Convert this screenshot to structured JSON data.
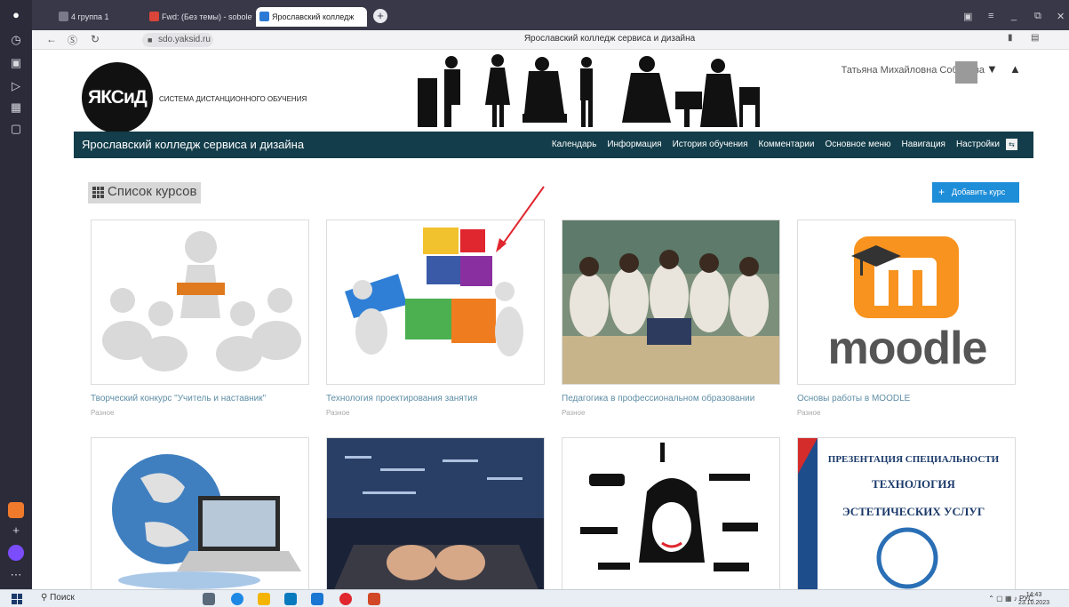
{
  "browser": {
    "tabs": [
      {
        "label": "4  группа 1"
      },
      {
        "label": "Fwd: (Без темы) - sobolev"
      },
      {
        "label": "Ярославский колледж"
      }
    ],
    "url": "sdo.yaksid.ru",
    "page_title": "Ярославский колледж сервиса и дизайна"
  },
  "site": {
    "logo_text": "ЯКСиД",
    "logo_subtitle": "СИСТЕМА ДИСТАНЦИОННОГО ОБУЧЕНИЯ",
    "user_name": "Татьяна Михайловна Соболева",
    "brand": "Ярославский колледж сервиса и дизайна",
    "menu": [
      "Календарь",
      "Информация",
      "История обучения",
      "Комментарии",
      "Основное меню",
      "Навигация",
      "Настройки"
    ]
  },
  "courses": {
    "heading": "Список курсов",
    "add_label": "Добавить курс",
    "items": [
      {
        "name": "Творческий конкурс \"Учитель и наставник\"",
        "category": "Разное"
      },
      {
        "name": "Технология проектирования занятия",
        "category": "Разное"
      },
      {
        "name": "Педагогика в профессиональном образовании",
        "category": "Разное"
      },
      {
        "name": "Основы работы в MOODLE",
        "category": "Разное"
      }
    ],
    "moodle_logo_text": "moodle",
    "presentation": {
      "line1": "ПРЕЗЕНТАЦИЯ СПЕЦИАЛЬНОСТИ",
      "line2": "ТЕХНОЛОГИЯ",
      "line3": "ЭСТЕТИЧЕСКИХ УСЛУГ"
    }
  },
  "taskbar": {
    "search_label": "Поиск",
    "lang": "РУС",
    "time": "14:43",
    "date": "23.10.2023"
  }
}
